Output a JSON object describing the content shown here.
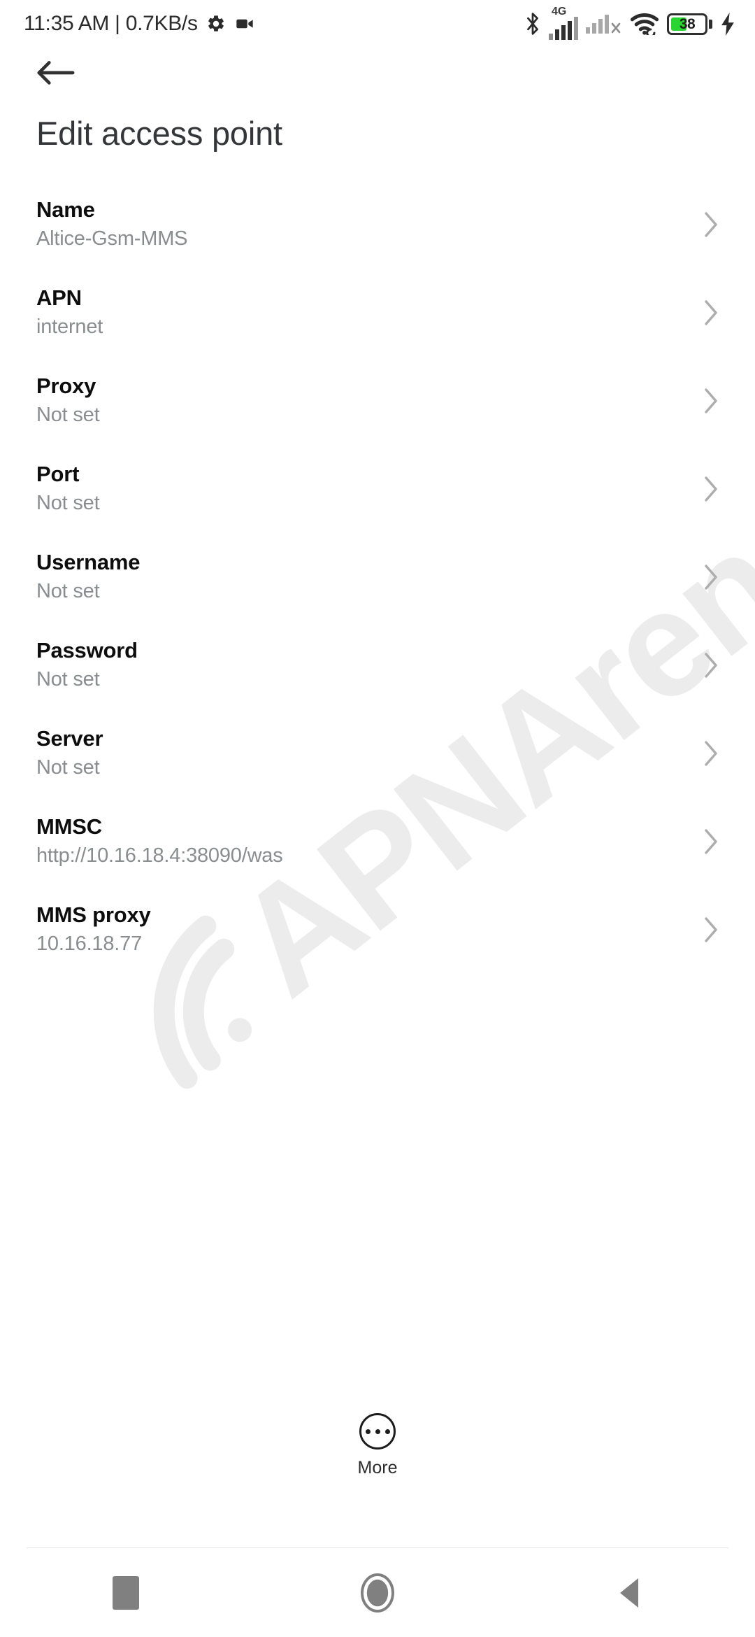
{
  "status_bar": {
    "clock_and_net": "11:35 AM | 0.7KB/s",
    "icons_left": [
      "gear-icon",
      "video-camera-icon"
    ],
    "icons_right": [
      "bluetooth-icon",
      "signal-4g-icon",
      "signal-sim2-no-service-icon",
      "wifi-icon",
      "battery-icon",
      "charging-bolt-icon"
    ],
    "network_type": "4G",
    "battery_percent": "38",
    "battery_color": "#2bd531",
    "charging": true
  },
  "header": {
    "back_icon": "arrow-left-icon",
    "title": "Edit access point"
  },
  "watermark": {
    "text": "APNArena",
    "color": "#ececec"
  },
  "settings": {
    "chevron_icon": "chevron-right-icon",
    "rows": [
      {
        "label": "Name",
        "value": "Altice-Gsm-MMS"
      },
      {
        "label": "APN",
        "value": "internet"
      },
      {
        "label": "Proxy",
        "value": "Not set"
      },
      {
        "label": "Port",
        "value": "Not set"
      },
      {
        "label": "Username",
        "value": "Not set"
      },
      {
        "label": "Password",
        "value": "Not set"
      },
      {
        "label": "Server",
        "value": "Not set"
      },
      {
        "label": "MMSC",
        "value": "http://10.16.18.4:38090/was"
      },
      {
        "label": "MMS proxy",
        "value": "10.16.18.77"
      }
    ]
  },
  "more": {
    "label": "More",
    "icon": "three-dots-circle-icon"
  },
  "nav_bar": {
    "recents": "square-icon",
    "home": "circle-icon",
    "back": "triangle-left-icon"
  }
}
